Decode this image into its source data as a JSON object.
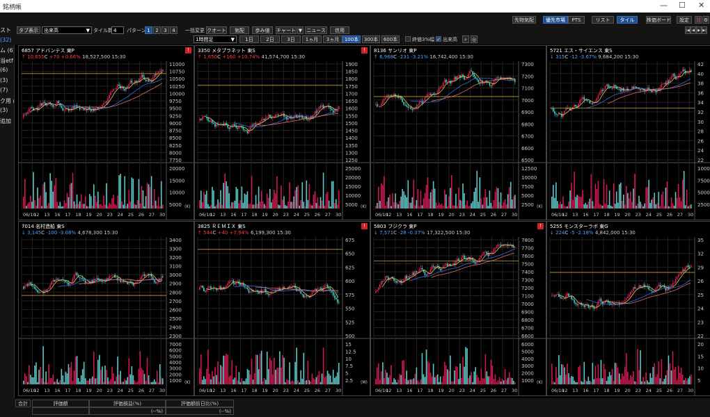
{
  "window": {
    "title": "銘柄帳",
    "controls": [
      "—",
      "☐",
      "✕"
    ]
  },
  "sidebar": {
    "items": [
      {
        "label": "スト",
        "selected": false
      },
      {
        "label": "(32)",
        "selected": true
      },
      {
        "label": "ム (6)",
        "selected": false
      },
      {
        "label": "当etf",
        "selected": false
      },
      {
        "label": "(6)",
        "selected": false
      },
      {
        "label": "(3)",
        "selected": false
      },
      {
        "label": "(7)",
        "selected": false
      },
      {
        "label": "ク用 (",
        "selected": false
      },
      {
        "label": "(3)",
        "selected": false
      },
      {
        "label": "追加",
        "selected": false
      }
    ]
  },
  "toolbar": {
    "tab_display_label": "タブ表示",
    "sort_value": "出来高",
    "tile_count_label": "タイル数",
    "tile_count_value": "4",
    "pattern_label": "パターン",
    "patterns": [
      "1",
      "2",
      "3",
      "4"
    ],
    "bulk_change_label": "一括変更",
    "view_buttons": [
      "クオート",
      "気配",
      "歩み値",
      "チャート",
      "ニュース",
      "信用"
    ],
    "right_buttons": [
      "先物気配",
      "優先市場",
      "PTS",
      "リスト",
      "タイル",
      "株価ボード",
      "設定"
    ],
    "period_value": "1時間足",
    "ranges": [
      "1日",
      "2日",
      "3日",
      "1ヵ月",
      "3ヵ月"
    ],
    "bar_counts": [
      "100本",
      "300本",
      "600本"
    ],
    "checks": [
      {
        "label": "終値3%幅",
        "checked": false
      },
      {
        "label": "出来高",
        "checked": true
      }
    ],
    "nav_icons": [
      "first-icon",
      "prev-icon",
      "next-icon",
      "last-icon"
    ]
  },
  "panels": [
    {
      "code": "6857",
      "name": "アドバンテス",
      "market": "東P",
      "arrow": "↑",
      "price": "10,655",
      "flag": "C",
      "change": "+70 +0.66%",
      "volume": "18,527,500",
      "time": "15:30",
      "dir": "up",
      "alert": true,
      "price_ticks": [
        "11000",
        "10750",
        "10500",
        "10250",
        "10000",
        "9750",
        "9500",
        "9250",
        "9000",
        "8750",
        "8500",
        "8250",
        "8000",
        "7750"
      ],
      "vol_ticks": [
        "20000",
        "15000",
        "10000",
        "5000"
      ],
      "vol_unit": "(K)",
      "x_ticks": [
        "06/10",
        "12",
        "13",
        "16",
        "17",
        "18",
        "19",
        "20",
        "23",
        "24",
        "25",
        "26",
        "27",
        "30"
      ]
    },
    {
      "code": "3350",
      "name": "メタプラネット",
      "market": "東S",
      "arrow": "↑",
      "price": "1,650",
      "flag": "C",
      "change": "+160 +10.74%",
      "volume": "41,574,700",
      "time": "15:30",
      "dir": "up",
      "alert": true,
      "price_ticks": [
        "1900",
        "1850",
        "1800",
        "1750",
        "1700",
        "1650",
        "1600",
        "1550",
        "1500",
        "1450",
        "1400",
        "1350",
        "1300",
        "1250"
      ],
      "vol_ticks": [
        "25000",
        "20000",
        "15000",
        "10000",
        "5000"
      ],
      "vol_unit": "(K)",
      "x_ticks": [
        "06/10",
        "12",
        "13",
        "16",
        "17",
        "18",
        "19",
        "20",
        "23",
        "24",
        "25",
        "26",
        "27",
        "30"
      ]
    },
    {
      "code": "8136",
      "name": "サンリオ",
      "market": "東P",
      "arrow": "↑",
      "price": "6,968",
      "flag": "C",
      "change": "-231 -3.21%",
      "volume": "16,742,400",
      "time": "15:30",
      "dir": "dn",
      "alert": false,
      "price_ticks": [
        "7300",
        "7200",
        "7100",
        "7000",
        "6900",
        "6800",
        "6700",
        "6600",
        "6500"
      ],
      "vol_ticks": [
        "12500",
        "10000",
        "7500",
        "5000",
        "2500"
      ],
      "vol_unit": "(K)",
      "x_ticks": [
        "06/10",
        "12",
        "13",
        "16",
        "17",
        "18",
        "19",
        "20",
        "23",
        "24",
        "25",
        "26",
        "27",
        "30"
      ]
    },
    {
      "code": "5721",
      "name": "エス・サイエンス",
      "market": "東S",
      "arrow": "↓",
      "price": "315",
      "flag": "C",
      "change": "-12 -3.67%",
      "volume": "9,684,200",
      "time": "15:30",
      "dir": "dn",
      "alert": false,
      "price_ticks": [
        "42",
        "40",
        "38",
        "36",
        "34",
        "32",
        "30",
        "28",
        "26",
        "24",
        "22"
      ],
      "vol_ticks": [
        "10000",
        "7500",
        "5000",
        "2500"
      ],
      "vol_unit": "(K)",
      "x_ticks": [
        "06/10",
        "12",
        "13",
        "16",
        "17",
        "18",
        "19",
        "20",
        "23",
        "24",
        "25",
        "26",
        "27",
        "30"
      ]
    },
    {
      "code": "7014",
      "name": "名村造船",
      "market": "東S",
      "arrow": "↓",
      "price": "3,145",
      "flag": "C",
      "change": "-100 -3.08%",
      "volume": "4,678,300",
      "time": "15:30",
      "dir": "dn",
      "alert": false,
      "price_ticks": [
        "3400",
        "3300",
        "3200",
        "3100",
        "3000",
        "2900",
        "2800",
        "2700",
        "2600",
        "2500",
        "2400",
        "2300"
      ],
      "vol_ticks": [
        "7000",
        "6000",
        "5000",
        "4000",
        "3000",
        "2000",
        "1000"
      ],
      "vol_unit": "(K)",
      "x_ticks": [
        "06/10",
        "12",
        "13",
        "16",
        "17",
        "18",
        "19",
        "20",
        "23",
        "24",
        "25",
        "26",
        "27",
        "30"
      ]
    },
    {
      "code": "3825",
      "name": "ＲＥＭＩＸ",
      "market": "東S",
      "arrow": "↑",
      "price": "544",
      "flag": "C",
      "change": "+40 +7.94%",
      "volume": "6,199,300",
      "time": "15:30",
      "dir": "up",
      "alert": true,
      "price_ticks": [
        "675",
        "650",
        "625",
        "600",
        "575",
        "550",
        "525",
        "500"
      ],
      "vol_ticks": [
        "15",
        "12.5",
        "10",
        "7.5",
        "5",
        "2.5"
      ],
      "vol_unit": "(M)",
      "x_ticks": [
        "06/10",
        "12",
        "13",
        "16",
        "17",
        "18",
        "19",
        "20",
        "23",
        "24",
        "25",
        "26",
        "27",
        "30"
      ]
    },
    {
      "code": "5803",
      "name": "フジクラ",
      "market": "東P",
      "arrow": "↓",
      "price": "7,571",
      "flag": "C",
      "change": "-28 -0.37%",
      "volume": "17,322,500",
      "time": "15:30",
      "dir": "dn",
      "alert": true,
      "price_ticks": [
        "7800",
        "7700",
        "7600",
        "7500",
        "7400",
        "7300",
        "7200",
        "7100",
        "7000",
        "6900",
        "6800",
        "6700",
        "6600"
      ],
      "vol_ticks": [
        "6000",
        "5000",
        "4000",
        "3000",
        "2000",
        "1000"
      ],
      "vol_unit": "(K)",
      "x_ticks": [
        "06/10",
        "12",
        "13",
        "16",
        "17",
        "18",
        "19",
        "20",
        "23",
        "24",
        "25",
        "26",
        "27",
        "30"
      ]
    },
    {
      "code": "5255",
      "name": "モンスターラボ",
      "market": "東G",
      "arrow": "↓",
      "price": "224",
      "flag": "C",
      "change": "-5 -2.18%",
      "volume": "4,842,000",
      "time": "15:30",
      "dir": "dn",
      "alert": false,
      "price_ticks": [
        "35",
        "32",
        "29",
        "26",
        "25",
        "24",
        "23",
        "22"
      ],
      "vol_ticks": [
        "20",
        "15",
        "10",
        "5"
      ],
      "vol_unit": "(K)",
      "x_ticks": [
        "06/10",
        "12",
        "13",
        "16",
        "17",
        "18",
        "19",
        "20",
        "23",
        "24",
        "25",
        "26",
        "27",
        "30"
      ]
    }
  ],
  "bottom": {
    "total_label": "合計",
    "headers": [
      "評価額",
      "評価損益(%)",
      "評価額前日比(%)"
    ],
    "values": [
      "",
      "(--%)",
      "(--%)"
    ]
  },
  "colors": {
    "up": "#ff3b3b",
    "down": "#4da3ff",
    "candle_up": "#e0205a",
    "candle_down": "#40d0d0",
    "ma1": "#d8d060",
    "ma2": "#3070e0",
    "ma3": "#e07060",
    "hline": "#c8a030",
    "vol_up": "#d01850",
    "vol_down": "#60c8c8"
  }
}
